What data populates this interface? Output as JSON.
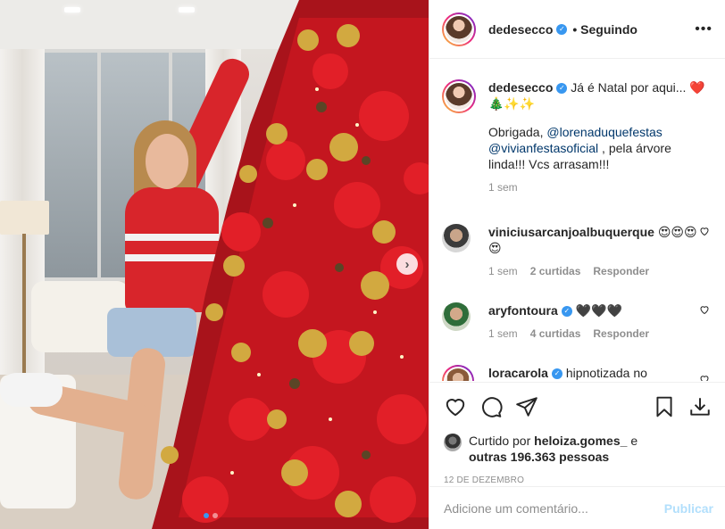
{
  "post": {
    "author": "dedesecco",
    "follow_status": "• Seguindo",
    "more_icon": "more-horizontal-icon"
  },
  "caption": {
    "username": "dedesecco",
    "text_part1": "Já é Natal por aqui... ❤️🎄✨✨",
    "thanks": "Obrigada,",
    "mention1": "@lorenaduquefestas",
    "mention2": "@vivianfestasoficial",
    "text_part2": ", pela árvore linda!!! Vcs arrasam!!!",
    "time": "1 sem"
  },
  "comments": [
    {
      "username": "viniciusarcanjoalbuquerque",
      "text": "😍😍😍😍",
      "time": "1 sem",
      "likes": "2 curtidas",
      "reply": "Responder",
      "verified": false
    },
    {
      "username": "aryfontoura",
      "text": "🖤🖤🖤",
      "time": "1 sem",
      "likes": "4 curtidas",
      "reply": "Responder",
      "verified": true
    },
    {
      "username": "loracarola",
      "text": "hipnotizada no",
      "verified": true
    }
  ],
  "likes_line": {
    "prefix": "Curtido por",
    "user": "heloiza.gomes_",
    "connector": "e",
    "others": "outras 196.363 pessoas"
  },
  "date": "12 de dezembro",
  "add_comment": {
    "placeholder": "Adicione um comentário...",
    "publish": "Publicar"
  },
  "carousel": {
    "next_glyph": "›",
    "slides": 2,
    "active": 1
  },
  "colors": {
    "accent": "#3897f0",
    "publish_disabled": "#b2dffc",
    "secondary_text": "#8e8e8e",
    "mention": "#00376b"
  }
}
